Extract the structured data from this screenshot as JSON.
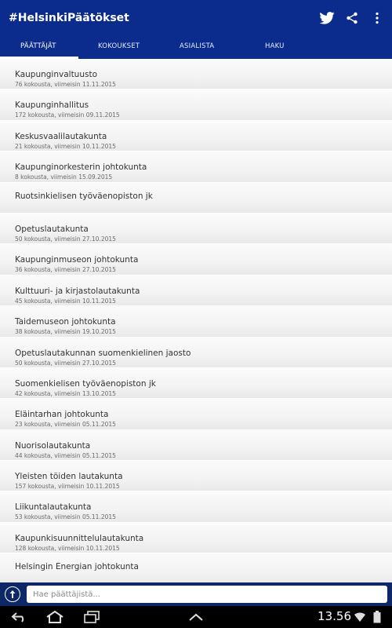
{
  "app": {
    "title": "#HelsinkiPäätökset"
  },
  "actions": {
    "twitter": "twitter-icon",
    "share": "share-icon",
    "more": "overflow-menu-icon"
  },
  "tabs": [
    {
      "label": "PÄÄTTÄJÄT"
    },
    {
      "label": "KOKOUKSET"
    },
    {
      "label": "ASIALISTA"
    },
    {
      "label": "HAKU"
    }
  ],
  "committees": [
    {
      "name": "Kaupunginvaltuusto",
      "meta": "76 kokousta, viimeisin 11.11.2015"
    },
    {
      "name": "Kaupunginhallitus",
      "meta": "172 kokousta, viimeisin 09.11.2015"
    },
    {
      "name": "Keskusvaalilautakunta",
      "meta": "21 kokousta, viimeisin 10.11.2015"
    },
    {
      "name": "Kaupunginorkesterin johtokunta",
      "meta": "8 kokousta, viimeisin 15.09.2015"
    },
    {
      "name": "Ruotsinkielisen työväenopiston jk",
      "meta": ""
    },
    {
      "name": "Opetuslautakunta",
      "meta": "50 kokousta, viimeisin 27.10.2015"
    },
    {
      "name": "Kaupunginmuseon johtokunta",
      "meta": "36 kokousta, viimeisin 27.10.2015"
    },
    {
      "name": "Kulttuuri- ja kirjastolautakunta",
      "meta": "45 kokousta, viimeisin 10.11.2015"
    },
    {
      "name": "Taidemuseon johtokunta",
      "meta": "38 kokousta, viimeisin 19.10.2015"
    },
    {
      "name": "Opetuslautakunnan suomenkielinen jaosto",
      "meta": "50 kokousta, viimeisin 27.10.2015"
    },
    {
      "name": "Suomenkielisen työväenopiston jk",
      "meta": "42 kokousta, viimeisin 13.10.2015"
    },
    {
      "name": "Eläintarhan johtokunta",
      "meta": "23 kokousta, viimeisin 05.11.2015"
    },
    {
      "name": "Nuorisolautakunta",
      "meta": "44 kokousta, viimeisin 05.11.2015"
    },
    {
      "name": "Yleisten töiden lautakunta",
      "meta": "157 kokousta, viimeisin 10.11.2015"
    },
    {
      "name": "Liikuntalautakunta",
      "meta": "53 kokousta, viimeisin 05.11.2015"
    },
    {
      "name": "Kaupunkisuunnittelulautakunta",
      "meta": "128 kokousta, viimeisin 10.11.2015"
    },
    {
      "name": "Helsingin Energian johtokunta",
      "meta": ""
    }
  ],
  "search": {
    "placeholder": "Hae päättäjistä..."
  },
  "system": {
    "time": "13.56"
  },
  "colors": {
    "appbar": "#0b2c8c",
    "searchbar": "#0e2767",
    "navbar": "#000000"
  }
}
